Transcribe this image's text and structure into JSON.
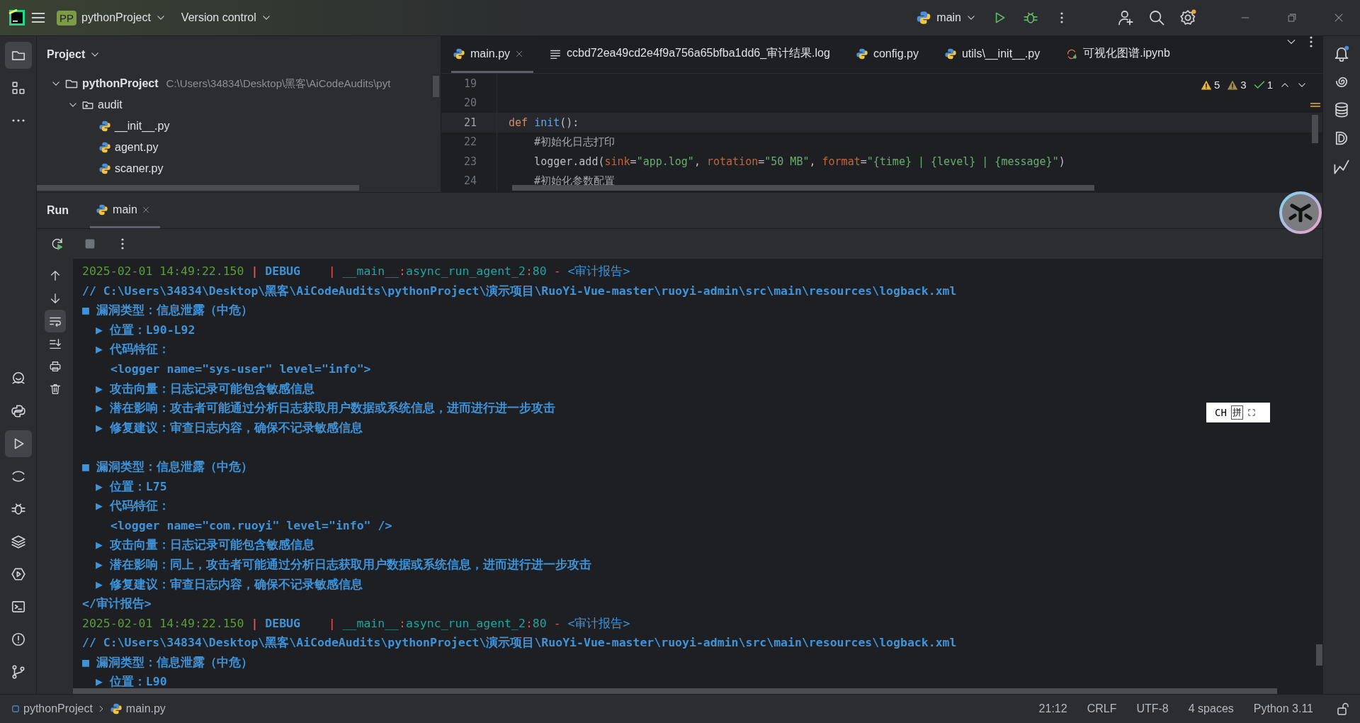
{
  "title_bar": {
    "project_badge": "PP",
    "project": "pythonProject",
    "vcs": "Version control",
    "run_config": "main"
  },
  "left_toolbar": {
    "top": [
      {
        "kind": "folder",
        "selected": true
      },
      {
        "kind": "structure",
        "selected": false
      },
      {
        "kind": "more",
        "selected": false
      }
    ],
    "bottom": [
      {
        "kind": "robot",
        "selected": false
      },
      {
        "kind": "python",
        "selected": false
      },
      {
        "kind": "run",
        "selected": true
      },
      {
        "kind": "arc",
        "selected": false
      },
      {
        "kind": "bug",
        "selected": false
      },
      {
        "kind": "layers",
        "selected": false
      },
      {
        "kind": "services",
        "selected": false
      },
      {
        "kind": "terminal",
        "selected": false
      },
      {
        "kind": "problems",
        "selected": false
      },
      {
        "kind": "git",
        "selected": false
      }
    ]
  },
  "project_panel": {
    "title": "Project",
    "tree": [
      {
        "label": "pythonProject",
        "path": "C:\\Users\\34834\\Desktop\\黑客\\AiCodeAudits\\pyt",
        "kind": "folder",
        "expanded": true,
        "children": [
          {
            "label": "audit",
            "kind": "package",
            "expanded": true,
            "children": [
              {
                "label": "__init__.py",
                "kind": "python"
              },
              {
                "label": "agent.py",
                "kind": "python"
              },
              {
                "label": "scaner.py",
                "kind": "python"
              }
            ]
          }
        ]
      }
    ]
  },
  "editor_tabs": [
    {
      "label": "main.py",
      "kind": "python",
      "selected": true
    },
    {
      "label": "ccbd72ea49cd2e4f9a756a65bfba1dd6_审计结果.log",
      "kind": "text",
      "selected": false
    },
    {
      "label": "config.py",
      "kind": "python",
      "selected": false
    },
    {
      "label": "utils\\__init__.py",
      "kind": "python",
      "selected": false
    },
    {
      "label": "可视化图谱.ipynb",
      "kind": "notebook",
      "selected": false
    }
  ],
  "inspections": [
    {
      "kind": "warning",
      "count": "5"
    },
    {
      "kind": "weak",
      "count": "3"
    },
    {
      "kind": "ok",
      "count": "1"
    }
  ],
  "editor": {
    "lines": [
      {
        "number": "19",
        "current": false
      },
      {
        "number": "20",
        "current": false
      },
      {
        "number": "21",
        "current": true,
        "tokens": [
          {
            "text": "def ",
            "color": "#cf8e6d"
          },
          {
            "text": "init",
            "color": "#56a8f5"
          },
          {
            "text": "():",
            "color": "#bcbec4"
          }
        ]
      },
      {
        "number": "22",
        "current": false,
        "tokens": [
          {
            "text": "    #初始化日志打印",
            "color": "#a6a8ad"
          }
        ]
      },
      {
        "number": "23",
        "current": false,
        "tokens": [
          {
            "text": "    logger.add(",
            "color": "#bcbec4"
          },
          {
            "text": "sink",
            "color": "#c0663f"
          },
          {
            "text": "=",
            "color": "#bcbec4"
          },
          {
            "text": "\"app.log\"",
            "color": "#6aab73"
          },
          {
            "text": ", ",
            "color": "#bcbec4"
          },
          {
            "text": "rotation",
            "color": "#c0663f"
          },
          {
            "text": "=",
            "color": "#bcbec4"
          },
          {
            "text": "\"50 MB\"",
            "color": "#6aab73"
          },
          {
            "text": ", ",
            "color": "#bcbec4"
          },
          {
            "text": "format",
            "color": "#c0663f"
          },
          {
            "text": "=",
            "color": "#bcbec4"
          },
          {
            "text": "\"{time} | {level} | {message}\"",
            "color": "#6aab73"
          },
          {
            "text": ")",
            "color": "#bcbec4"
          }
        ]
      },
      {
        "number": "24",
        "current": false,
        "tokens": [
          {
            "text": "    #初始化参数配置",
            "color": "#a6a8ad"
          }
        ]
      }
    ]
  },
  "run_panel": {
    "title": "Run",
    "tabs": [
      {
        "label": "main",
        "selected": true
      }
    ],
    "console": [
      {
        "kind": "log",
        "segments": [
          {
            "text": "2025-02-01 14:49:22.150",
            "color": "#5d9c3c",
            "bold": false
          },
          {
            "text": " | ",
            "color": "#e55353",
            "bold": true
          },
          {
            "text": "DEBUG",
            "color": "#3f93d9",
            "bold": true
          },
          {
            "text": "    | ",
            "color": "#e55353",
            "bold": false
          },
          {
            "text": "__main__",
            "color": "#24a39a",
            "bold": false
          },
          {
            "text": ":",
            "color": "#e55353",
            "bold": false
          },
          {
            "text": "async_run_agent_2",
            "color": "#24a39a",
            "bold": false
          },
          {
            "text": ":",
            "color": "#e55353",
            "bold": false
          },
          {
            "text": "80",
            "color": "#24a39a",
            "bold": false
          },
          {
            "text": " - ",
            "color": "#e55353",
            "bold": false
          },
          {
            "text": "<审计报告>",
            "color": "#3f93d9",
            "bold": false
          }
        ]
      },
      {
        "kind": "path",
        "text": "// C:\\Users\\34834\\Desktop\\黑客\\AiCodeAudits\\pythonProject\\演示项目\\RuoYi-Vue-master\\ruoyi-admin\\src\\main\\resources\\logback.xml"
      },
      {
        "kind": "heading",
        "text": "■ 漏洞类型：信息泄露（中危）"
      },
      {
        "kind": "item",
        "text": "▶ 位置：L90-L92"
      },
      {
        "kind": "item",
        "text": "▶ 代码特征："
      },
      {
        "kind": "code",
        "text": "<logger name=\"sys-user\" level=\"info\">"
      },
      {
        "kind": "item",
        "text": "▶ 攻击向量：日志记录可能包含敏感信息"
      },
      {
        "kind": "item",
        "text": "▶ 潜在影响：攻击者可能通过分析日志获取用户数据或系统信息，进而进行进一步攻击"
      },
      {
        "kind": "item",
        "text": "▶ 修复建议：审查日志内容，确保不记录敏感信息"
      },
      {
        "kind": "blank"
      },
      {
        "kind": "heading",
        "text": "■ 漏洞类型：信息泄露（中危）"
      },
      {
        "kind": "item",
        "text": "▶ 位置：L75"
      },
      {
        "kind": "item",
        "text": "▶ 代码特征："
      },
      {
        "kind": "code",
        "text": "<logger name=\"com.ruoyi\" level=\"info\" />"
      },
      {
        "kind": "item",
        "text": "▶ 攻击向量：日志记录可能包含敏感信息"
      },
      {
        "kind": "item",
        "text": "▶ 潜在影响：同上，攻击者可能通过分析日志获取用户数据或系统信息，进而进行进一步攻击"
      },
      {
        "kind": "item",
        "text": "▶ 修复建议：审查日志内容，确保不记录敏感信息"
      },
      {
        "kind": "plain",
        "text": "</审计报告>"
      },
      {
        "kind": "log",
        "segments": [
          {
            "text": "2025-02-01 14:49:22.150",
            "color": "#5d9c3c",
            "bold": false
          },
          {
            "text": " | ",
            "color": "#e55353",
            "bold": true
          },
          {
            "text": "DEBUG",
            "color": "#3f93d9",
            "bold": true
          },
          {
            "text": "    | ",
            "color": "#e55353",
            "bold": false
          },
          {
            "text": "__main__",
            "color": "#24a39a",
            "bold": false
          },
          {
            "text": ":",
            "color": "#e55353",
            "bold": false
          },
          {
            "text": "async_run_agent_2",
            "color": "#24a39a",
            "bold": false
          },
          {
            "text": ":",
            "color": "#e55353",
            "bold": false
          },
          {
            "text": "80",
            "color": "#24a39a",
            "bold": false
          },
          {
            "text": " - ",
            "color": "#e55353",
            "bold": false
          },
          {
            "text": "<审计报告>",
            "color": "#3f93d9",
            "bold": false
          }
        ]
      },
      {
        "kind": "path",
        "text": "// C:\\Users\\34834\\Desktop\\黑客\\AiCodeAudits\\pythonProject\\演示项目\\RuoYi-Vue-master\\ruoyi-admin\\src\\main\\resources\\logback.xml"
      },
      {
        "kind": "heading",
        "text": "■ 漏洞类型：信息泄露（中危）"
      },
      {
        "kind": "item",
        "text": "▶ 位置：L90"
      }
    ]
  },
  "ime": {
    "mode": "CH",
    "layout": "拼"
  },
  "status_bar": {
    "breadcrumbs": [
      "pythonProject",
      "main.py"
    ],
    "items": [
      "21:12",
      "CRLF",
      "UTF-8",
      "4 spaces",
      "Python 3.11"
    ]
  }
}
